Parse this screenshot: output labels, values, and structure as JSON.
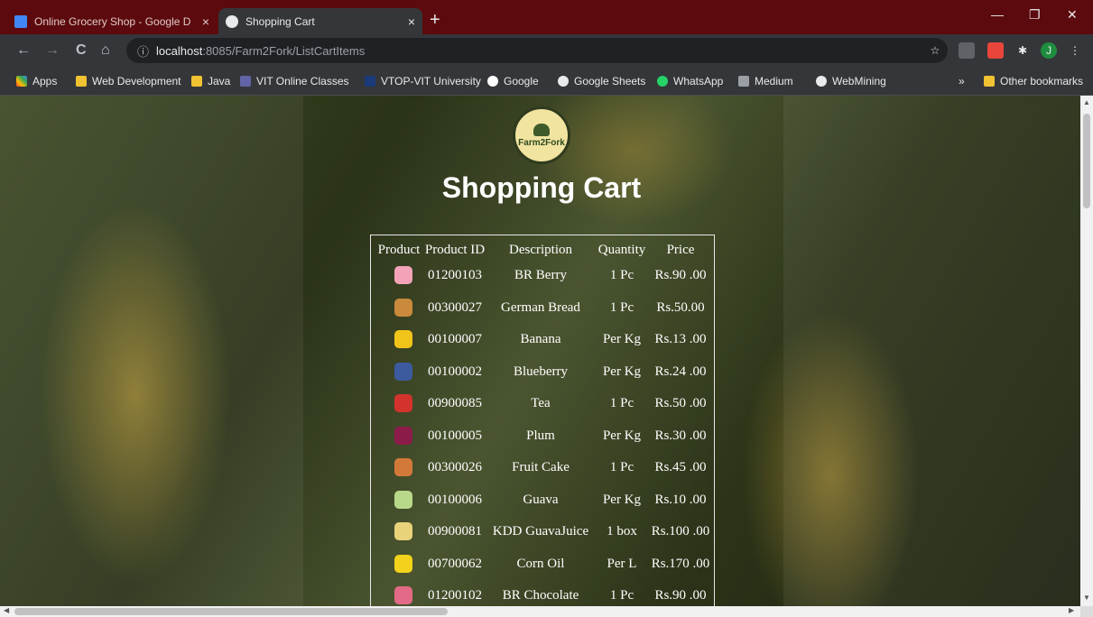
{
  "browser": {
    "tabs": [
      {
        "title": "Online Grocery Shop - Google D",
        "close": "×",
        "icon": "google-docs-icon",
        "active": false
      },
      {
        "title": "Shopping Cart",
        "close": "×",
        "icon": "globe-icon",
        "active": true
      }
    ],
    "new_tab": "+",
    "window_controls": {
      "minimize": "—",
      "restore": "❐",
      "close": "✕"
    },
    "nav": {
      "back": "←",
      "forward": "→",
      "reload": "C",
      "home": "⌂"
    },
    "address": {
      "info": "ⓘ",
      "host": "localhost",
      "path": ":8085/Farm2Fork/ListCartItems"
    },
    "star": "☆",
    "profile_letter": "J",
    "menu": "⋮",
    "bookmarks": [
      {
        "label": "Apps",
        "icon": "apps-grid-icon"
      },
      {
        "label": "Web Development",
        "icon": "folder-icon"
      },
      {
        "label": "Java",
        "icon": "folder-icon"
      },
      {
        "label": "VIT Online Classes",
        "icon": "teams-icon"
      },
      {
        "label": "VTOP-VIT University",
        "icon": "site-icon"
      },
      {
        "label": "Google",
        "icon": "google-icon"
      },
      {
        "label": "Google Sheets",
        "icon": "globe-icon"
      },
      {
        "label": "WhatsApp",
        "icon": "whatsapp-icon"
      },
      {
        "label": "Medium",
        "icon": "medium-icon"
      },
      {
        "label": "WebMining",
        "icon": "globe-icon"
      }
    ],
    "more_bookmarks": "»",
    "other_bookmarks": "Other bookmarks"
  },
  "page": {
    "logo_text": "Farm2Fork",
    "title": "Shopping Cart",
    "columns": [
      "Product",
      "Product ID",
      "Description",
      "Quantity",
      "Price"
    ],
    "items": [
      {
        "id": "01200103",
        "description": "BR Berry",
        "quantity": "1 Pc",
        "price": "Rs.90 .00",
        "thumb_color": "#f2a3b8"
      },
      {
        "id": "00300027",
        "description": "German Bread",
        "quantity": "1 Pc",
        "price": "Rs.50.00",
        "thumb_color": "#c98a3c"
      },
      {
        "id": "00100007",
        "description": "Banana",
        "quantity": "Per Kg",
        "price": "Rs.13 .00",
        "thumb_color": "#f0c419"
      },
      {
        "id": "00100002",
        "description": "Blueberry",
        "quantity": "Per Kg",
        "price": "Rs.24 .00",
        "thumb_color": "#3d5a9e"
      },
      {
        "id": "00900085",
        "description": "Tea",
        "quantity": "1 Pc",
        "price": "Rs.50 .00",
        "thumb_color": "#d4322c"
      },
      {
        "id": "00100005",
        "description": "Plum",
        "quantity": "Per Kg",
        "price": "Rs.30 .00",
        "thumb_color": "#8b1c4a"
      },
      {
        "id": "00300026",
        "description": "Fruit Cake",
        "quantity": "1 Pc",
        "price": "Rs.45 .00",
        "thumb_color": "#d2793a"
      },
      {
        "id": "00100006",
        "description": "Guava",
        "quantity": "Per Kg",
        "price": "Rs.10 .00",
        "thumb_color": "#b9d98a"
      },
      {
        "id": "00900081",
        "description": "KDD GuavaJuice",
        "quantity": "1 box",
        "price": "Rs.100 .00",
        "thumb_color": "#e8d27a"
      },
      {
        "id": "00700062",
        "description": "Corn Oil",
        "quantity": "Per L",
        "price": "Rs.170 .00",
        "thumb_color": "#f2d21a"
      },
      {
        "id": "01200102",
        "description": "BR Chocolate",
        "quantity": "1 Pc",
        "price": "Rs.90 .00",
        "thumb_color": "#e26a86"
      }
    ]
  },
  "colors": {
    "tabbar": "#5c0a0d",
    "toolbar": "#35363a",
    "profile": "#1e8e3e"
  }
}
